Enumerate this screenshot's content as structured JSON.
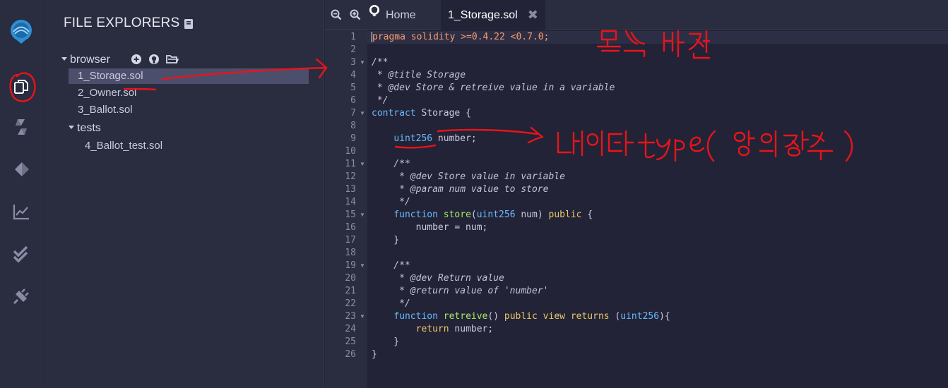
{
  "explorer": {
    "title": "FILE EXPLORERS",
    "folders": [
      {
        "label": "browser"
      },
      {
        "label": "tests"
      }
    ],
    "files": [
      {
        "label": "1_Storage.sol"
      },
      {
        "label": "2_Owner.sol"
      },
      {
        "label": "3_Ballot.sol"
      },
      {
        "label": "4_Ballot_test.sol"
      }
    ]
  },
  "rail_icons": [
    "remix-logo-icon",
    "file-explorer-icon",
    "solidity-compiler-icon",
    "deploy-run-icon",
    "analysis-icon",
    "testing-icon",
    "plugin-icon"
  ],
  "tabs": {
    "home": "Home",
    "active": "1_Storage.sol"
  },
  "code": {
    "lines": [
      "pragma solidity >=0.4.22 <0.7.0;",
      "",
      "/**",
      " * @title Storage",
      " * @dev Store & retreive value in a variable",
      " */",
      "contract Storage {",
      "",
      "    uint256 number;",
      "",
      "    /**",
      "     * @dev Store value in variable",
      "     * @param num value to store",
      "     */",
      "    function store(uint256 num) public {",
      "        number = num;",
      "    }",
      "",
      "    /**",
      "     * @dev Return value",
      "     * @return value of 'number'",
      "     */",
      "    function retreive() public view returns (uint256){",
      "        return number;",
      "    }",
      "}"
    ],
    "line_numbers": [
      "1",
      "2",
      "3",
      "4",
      "5",
      "6",
      "7",
      "8",
      "9",
      "10",
      "11",
      "12",
      "13",
      "14",
      "15",
      "16",
      "17",
      "18",
      "19",
      "20",
      "21",
      "22",
      "23",
      "24",
      "25",
      "26"
    ],
    "foldable_lines": [
      "3",
      "7",
      "11",
      "15",
      "19",
      "23"
    ]
  },
  "colors": {
    "background": "#222336",
    "panel": "#2a2c3f",
    "selected": "#4c4f6b",
    "annotation": "#e8141b"
  }
}
